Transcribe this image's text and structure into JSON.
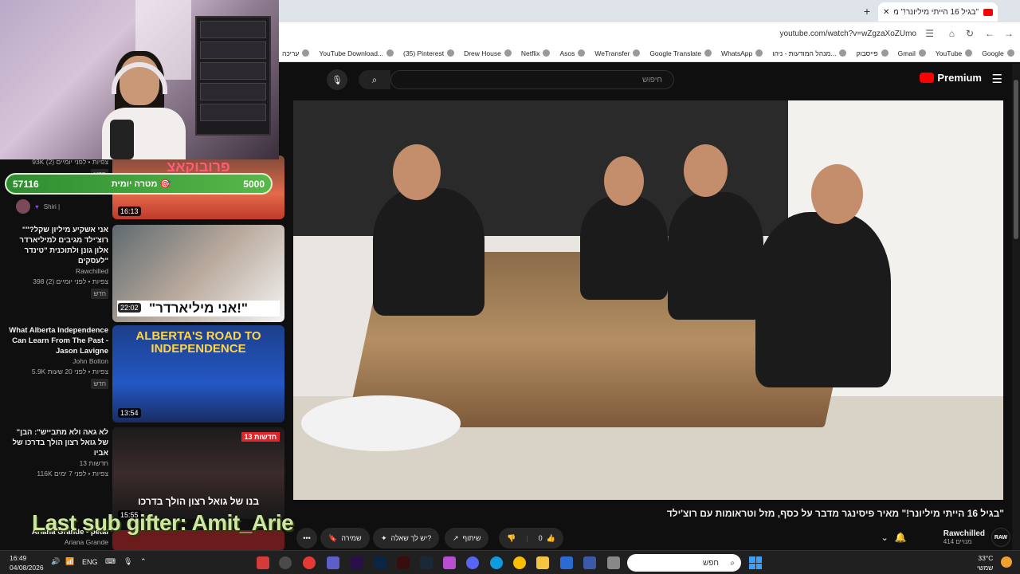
{
  "browser": {
    "tab_title": "\"בגיל 16 הייתי מיליונר!\" מא",
    "url": "youtube.com/watch?v=wZgzaXoZUmo",
    "new_tab": "+",
    "bookmarks": [
      "עריכה",
      "YouTube Download...",
      "(35) Pinterest",
      "Drew House",
      "Netflix",
      "Asos",
      "WeTransfer",
      "Google Translate",
      "WhatsApp",
      "מנהל המודעות - ניהו...",
      "פייסבוק",
      "Gmail",
      "YouTube",
      "Google"
    ]
  },
  "youtube": {
    "search_placeholder": "חיפוש",
    "logo_text": "Premium",
    "video_title": "\"בגיל 16 הייתי מיליונר!\" מאיר פיסינגר מדבר על כסף, מזל וטראומות עם רוצ'ילד",
    "channel_name": "Rawchilled",
    "channel_subs": "414 מנויים",
    "channel_avatar": "RAW",
    "likes": "0",
    "share_label": "שיתוף",
    "ask_label": "יש לך שאלה?",
    "save_label": "שמירה",
    "more_label": "•••"
  },
  "overlay": {
    "goal_current": "57116",
    "goal_label": "מטרה יומית",
    "goal_target": "5000",
    "last_sub": "Last sub gifter: Amit_Arie"
  },
  "recs": [
    {
      "title": "",
      "channel": "",
      "views": "93K צפיות • לפני יומיים (2)",
      "badge": "חדש",
      "duration": "16:13",
      "thumb_text": "פרובוקאצ"
    },
    {
      "title": "\"אני אשקיע מיליון שקל?\" רוצ'ילד מגיבים למיליארדר אלון גונן ולתוכנית \"טינדר לעסקים\"",
      "channel": "Rawchilled",
      "views": "398 צפיות • לפני יומיים (2)",
      "badge": "חדש",
      "duration": "22:02",
      "thumb_text": "\"אני מיליארדר!\""
    },
    {
      "title": "What Alberta Independence Can Learn From The Past - Jason Lavigne",
      "channel": "John Bolton",
      "views": "5.9K צפיות • לפני 20 שעות",
      "badge": "חדש",
      "duration": "13:54",
      "thumb_text": "ALBERTA'S ROAD TO INDEPENDENCE"
    },
    {
      "title": "\"לא גאה ולא מתבייש\": הבן של גואל רצון הולך בדרכו של אביו",
      "channel": "חדשות 13",
      "views": "116K צפיות • לפני 7 ימים",
      "badge": "",
      "duration": "15:55",
      "thumb_text": "בנו של גואל רצון הולך בדרכו"
    },
    {
      "title": "Ariana Grande - petal",
      "channel": "Ariana Grande",
      "views": "",
      "badge": "",
      "duration": "",
      "thumb_text": ""
    }
  ],
  "shiri_label": "Shiri |",
  "taskbar": {
    "time": "16:49",
    "date": "04/08/2026",
    "lang": "ENG",
    "search_placeholder": "חפש",
    "temp": "33°C",
    "weather": "שמשי"
  }
}
